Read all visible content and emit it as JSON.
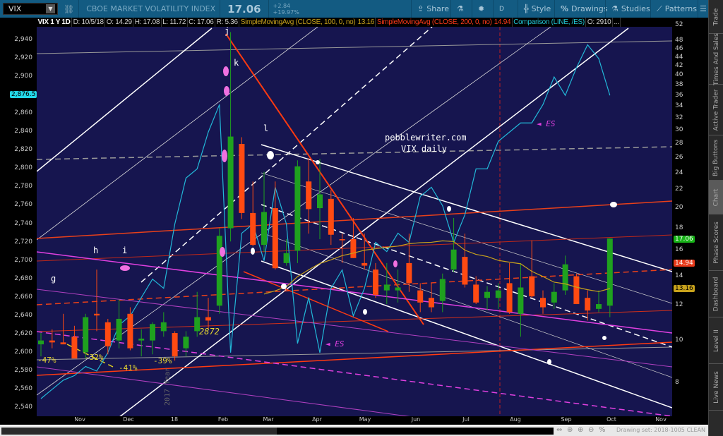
{
  "toolbar": {
    "symbol": "VIX",
    "description": "CBOE MARKET VOLATILITY INDEX",
    "last": "17.06",
    "change": "+2.84",
    "change_pct": "+19.97%",
    "buttons": [
      {
        "label": "Share",
        "icon": "share-icon"
      },
      {
        "label": "",
        "icon": "flask-icon"
      },
      {
        "label": "",
        "icon": "gear-icon"
      },
      {
        "label": "D",
        "icon": ""
      },
      {
        "label": "Style",
        "icon": "candle-icon"
      },
      {
        "label": "Drawings",
        "icon": "percent-icon"
      },
      {
        "label": "Studies",
        "icon": "flask-icon"
      },
      {
        "label": "Patterns",
        "icon": "pattern-icon"
      },
      {
        "label": "",
        "icon": "menu-icon"
      }
    ]
  },
  "info": {
    "title": "VIX 1 Y 1D",
    "date": "D: 10/5/18",
    "open": "O: 14.29",
    "high": "H: 17.08",
    "low": "L: 11.72",
    "close": "C: 17.06",
    "range": "R: 5.36",
    "sma100": "SimpleMovingAvg (CLOSE, 100, 0, no)",
    "sma100_val": "13.16",
    "sma200": "SimpleMovingAvg (CLOSE, 200, 0, no)",
    "sma200_val": "14.94",
    "comparison": "Comparison (LINE, /ES)",
    "comparison_open": "O: 2910",
    "more": "..."
  },
  "sidebar": {
    "tabs": [
      "Trade",
      "Times And Sales",
      "Active Trader",
      "Big Buttons",
      "Chart",
      "Phase Scores",
      "Dashboard",
      "Level II",
      "Live News"
    ],
    "selected": "Chart"
  },
  "badges": {
    "last": "17.06",
    "sma200": "14.94",
    "sma100": "13.16",
    "es": "2,876.5"
  },
  "colors": {
    "candle_up": "#1fa11f",
    "candle_down": "#ff4a12",
    "es": "#22b8d8",
    "sma100": "#c8a21c",
    "sma200": "#e0321a",
    "background": "#16154f"
  },
  "annotations": {
    "g": "g",
    "h": "h",
    "i": "i",
    "j": "j",
    "k": "k",
    "l": "l",
    "site": "pebblewriter.com",
    "subtitle": "VIX daily",
    "es1": "◄ ES",
    "es2": "◄ ES",
    "p47": "-47%",
    "p32": "-32%",
    "p41": "-41%",
    "p39": "-39%",
    "v2872": "2872",
    "year": "2017 Year"
  },
  "footer": {
    "drawing_set": "Drawing set: 2018-1005 CLEAN"
  },
  "chart_data": {
    "type": "candlestick+line",
    "title": "VIX 1 Y 1D",
    "x_ticks": [
      "Nov",
      "Dec",
      "18",
      "Feb",
      "Mar",
      "Apr",
      "May",
      "Jun",
      "Jul",
      "Aug",
      "Sep",
      "Oct",
      "Nov"
    ],
    "left_axis": {
      "label": "/ES",
      "ticks": [
        2540,
        2560,
        2580,
        2600,
        2620,
        2640,
        2660,
        2680,
        2700,
        2720,
        2740,
        2760,
        2780,
        2800,
        2820,
        2840,
        2860,
        2880,
        2900,
        2920,
        2940
      ],
      "range": [
        2535,
        2950
      ]
    },
    "right_axis": {
      "label": "VIX",
      "scale": "log",
      "ticks": [
        8,
        10,
        12,
        14,
        16,
        18,
        20,
        22,
        24,
        26,
        28,
        30,
        32,
        34,
        36,
        38,
        40,
        42,
        44,
        46,
        48,
        52
      ]
    },
    "vix_weekly_ohlc": [
      [
        9.8,
        10.4,
        9.2,
        10.0
      ],
      [
        10.0,
        10.6,
        9.6,
        9.9
      ],
      [
        9.9,
        11.5,
        9.8,
        9.8
      ],
      [
        10.2,
        10.8,
        9.2,
        9.1
      ],
      [
        9.4,
        11.5,
        9.1,
        11.3
      ],
      [
        11.5,
        14.5,
        10.5,
        11.4
      ],
      [
        11.0,
        11.2,
        9.3,
        9.7
      ],
      [
        10.0,
        12.4,
        9.6,
        11.2
      ],
      [
        11.5,
        11.9,
        9.5,
        9.6
      ],
      [
        10.0,
        10.6,
        9.2,
        10.1
      ],
      [
        10.0,
        11.0,
        9.3,
        10.9
      ],
      [
        10.5,
        11.6,
        10.2,
        11.0
      ],
      [
        10.4,
        10.5,
        9.0,
        9.2
      ],
      [
        9.6,
        10.5,
        9.2,
        10.2
      ],
      [
        10.5,
        12.9,
        10.2,
        11.3
      ],
      [
        11.3,
        12.5,
        10.6,
        11.1
      ],
      [
        12.0,
        18.0,
        11.5,
        17.3
      ],
      [
        18.0,
        50.3,
        16.8,
        29.1
      ],
      [
        28.0,
        29.0,
        18.9,
        19.5
      ],
      [
        19.5,
        23.0,
        16.4,
        16.5
      ],
      [
        16.5,
        24.2,
        15.9,
        19.6
      ],
      [
        20.0,
        23.0,
        14.5,
        14.6
      ],
      [
        15.0,
        17.0,
        14.8,
        15.8
      ],
      [
        16.0,
        25.7,
        15.0,
        24.9
      ],
      [
        23.0,
        26.0,
        17.5,
        19.9
      ],
      [
        20.0,
        25.9,
        17.0,
        21.5
      ],
      [
        21.0,
        22.0,
        16.5,
        17.4
      ],
      [
        17.0,
        17.5,
        15.0,
        16.9
      ],
      [
        17.0,
        19.0,
        15.4,
        15.4
      ],
      [
        15.0,
        17.5,
        14.5,
        14.8
      ],
      [
        14.5,
        15.0,
        12.5,
        12.7
      ],
      [
        13.0,
        15.0,
        12.1,
        13.4
      ],
      [
        13.0,
        14.5,
        12.2,
        13.2
      ],
      [
        15.0,
        17.5,
        12.9,
        13.5
      ],
      [
        13.0,
        13.5,
        11.6,
        12.2
      ],
      [
        12.5,
        13.5,
        11.6,
        11.9
      ],
      [
        12.3,
        14.2,
        11.6,
        13.8
      ],
      [
        14.5,
        19.0,
        14.3,
        16.1
      ],
      [
        15.5,
        17.5,
        13.2,
        13.4
      ],
      [
        13.4,
        14.0,
        12.1,
        12.2
      ],
      [
        12.5,
        13.3,
        11.7,
        12.9
      ],
      [
        12.5,
        13.5,
        11.8,
        13.0
      ],
      [
        13.5,
        15.0,
        11.5,
        11.6
      ],
      [
        11.5,
        15.0,
        10.2,
        13.2
      ],
      [
        14.0,
        16.9,
        12.5,
        12.6
      ],
      [
        12.5,
        13.0,
        11.5,
        11.9
      ],
      [
        12.2,
        13.5,
        11.8,
        12.9
      ],
      [
        13.0,
        15.6,
        12.7,
        14.9
      ],
      [
        14.0,
        14.2,
        12.1,
        12.1
      ],
      [
        12.5,
        13.0,
        11.1,
        11.7
      ],
      [
        11.8,
        13.0,
        11.6,
        12.1
      ],
      [
        12.0,
        17.08,
        11.3,
        17.06
      ]
    ],
    "es_weekly_close": [
      2550,
      2560,
      2570,
      2575,
      2585,
      2580,
      2600,
      2630,
      2640,
      2660,
      2680,
      2670,
      2740,
      2790,
      2800,
      2840,
      2870,
      2600,
      2730,
      2740,
      2700,
      2780,
      2740,
      2610,
      2660,
      2600,
      2670,
      2690,
      2640,
      2670,
      2720,
      2710,
      2730,
      2720,
      2770,
      2780,
      2760,
      2720,
      2750,
      2800,
      2800,
      2830,
      2840,
      2850,
      2850,
      2870,
      2900,
      2880,
      2910,
      2935,
      2920,
      2880
    ],
    "sma100_last": 13.16,
    "sma200_last": 14.94
  }
}
